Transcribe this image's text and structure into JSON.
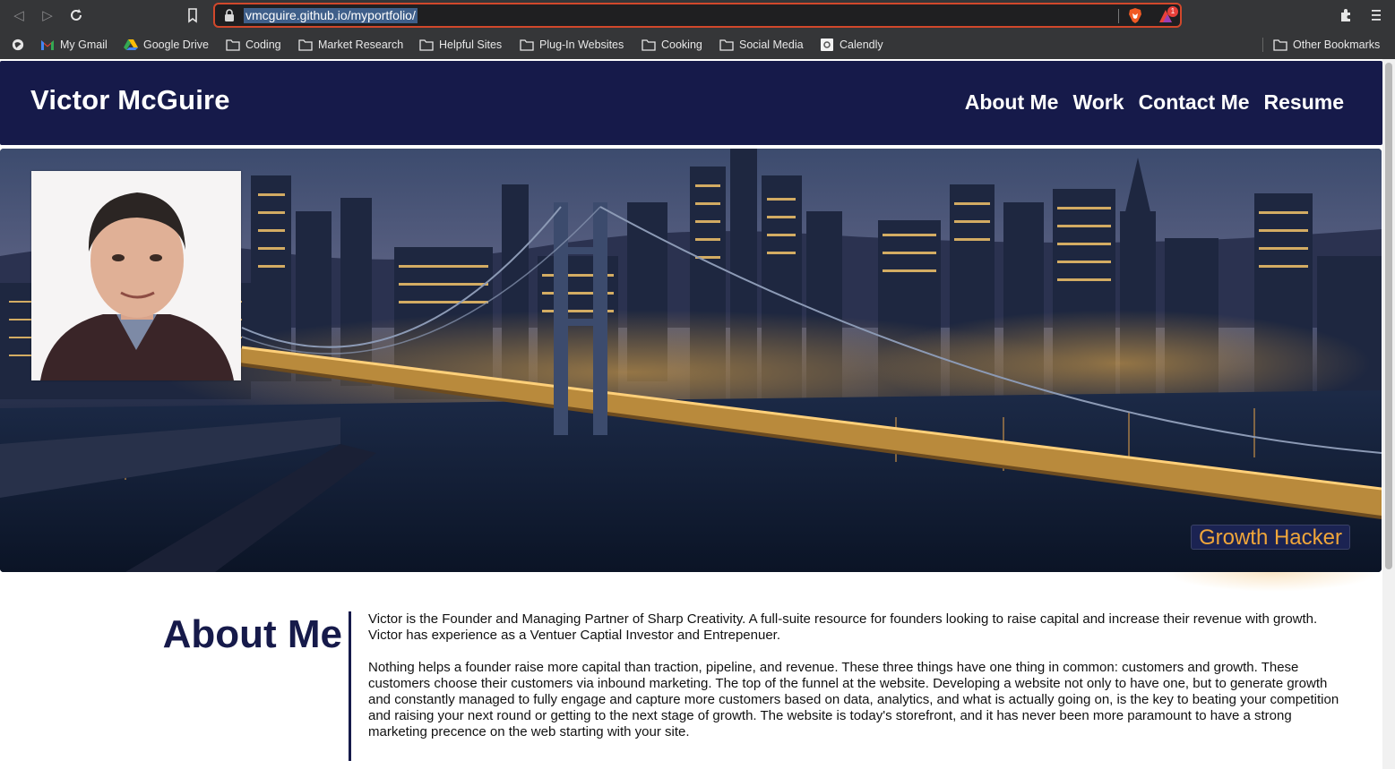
{
  "browser": {
    "url": "vmcguire.github.io/myportfolio/",
    "rewards_badge": "1",
    "bookmarks": [
      {
        "label": "My Gmail",
        "icon": "gmail-icon"
      },
      {
        "label": "Google Drive",
        "icon": "google-drive-icon"
      },
      {
        "label": "Coding",
        "icon": "folder-icon"
      },
      {
        "label": "Market Research",
        "icon": "folder-icon"
      },
      {
        "label": "Helpful Sites",
        "icon": "folder-icon"
      },
      {
        "label": "Plug-In Websites",
        "icon": "folder-icon"
      },
      {
        "label": "Cooking",
        "icon": "folder-icon"
      },
      {
        "label": "Social Media",
        "icon": "folder-icon"
      },
      {
        "label": "Calendly",
        "icon": "calendly-icon"
      }
    ],
    "other_bookmarks": "Other Bookmarks"
  },
  "site": {
    "title": "Victor McGuire",
    "nav": [
      "About Me",
      "Work",
      "Contact Me",
      "Resume"
    ],
    "tagline": "Growth Hacker"
  },
  "about": {
    "heading": "About Me",
    "paragraphs": [
      "Victor is the Founder and Managing Partner of Sharp Creativity. A full-suite resource for founders looking to raise capital and increase their revenue with growth. Victor has experience as a Ventuer Captial Investor and Entrepenuer.",
      "Nothing helps a founder raise more capital than traction, pipeline, and revenue. These three things have one thing in common: customers and growth. These customers choose their customers via inbound marketing. The top of the funnel at the website. Developing a website not only to have one, but to generate growth and constantly managed to fully engage and capture more customers based on data, analytics, and what is actually going on, is the key to beating your competition and raising your next round or getting to the next stage of growth. The website is today's storefront, and it has never been more paramount to have a strong marketing precence on the web starting with your site."
    ]
  },
  "colors": {
    "header_navy": "#161a4a",
    "tagline_orange": "#f0a63a",
    "url_outline": "#d1482b"
  }
}
